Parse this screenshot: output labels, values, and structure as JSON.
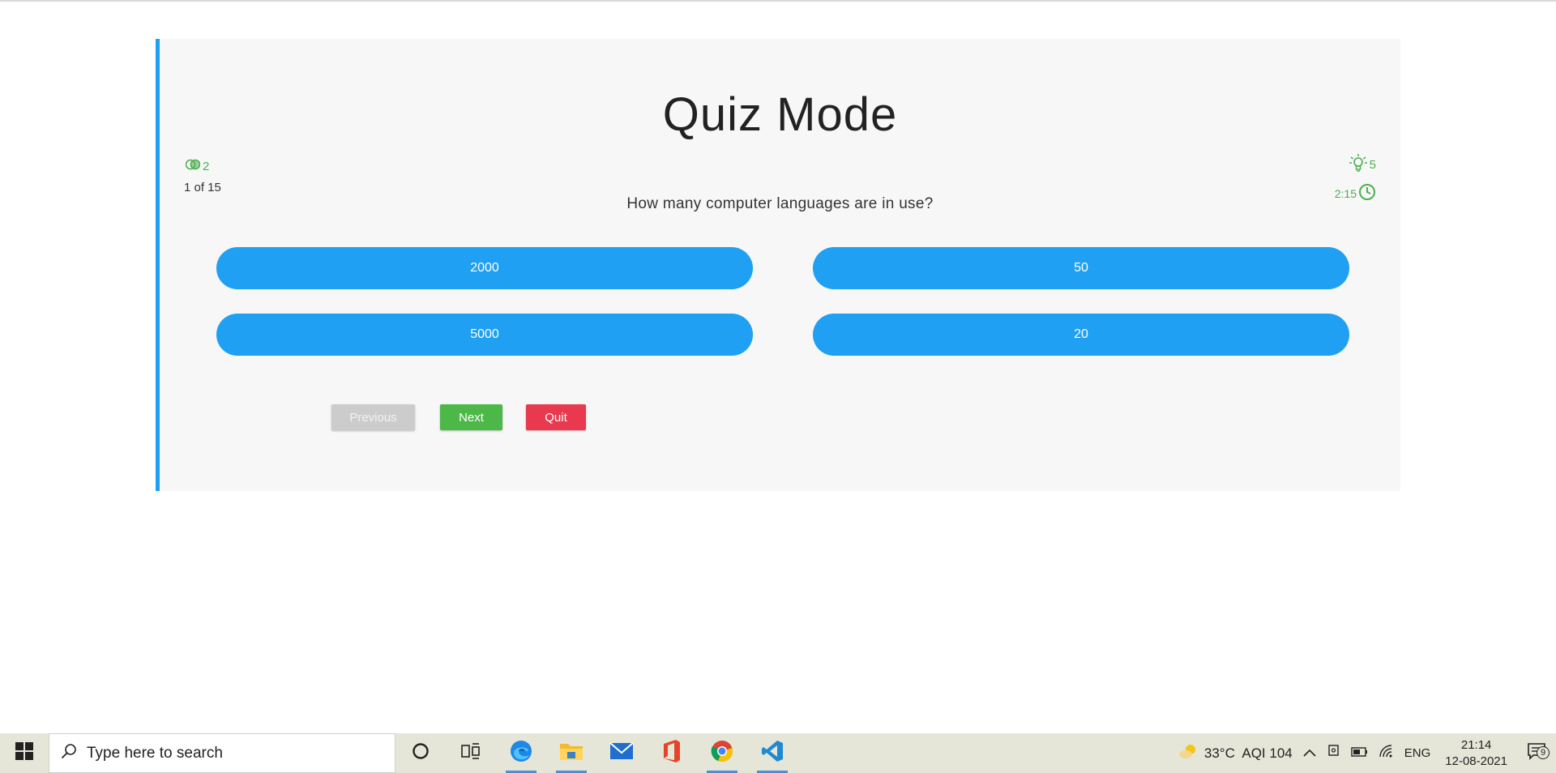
{
  "quiz": {
    "title": "Quiz Mode",
    "fifty_fifty_count": "2",
    "progress": "1 of 15",
    "hints_count": "5",
    "timer": "2:15",
    "question": "How many computer languages are in use?",
    "options": [
      "2000",
      "50",
      "5000",
      "20"
    ],
    "buttons": {
      "previous": "Previous",
      "next": "Next",
      "quit": "Quit"
    }
  },
  "taskbar": {
    "search_placeholder": "Type here to search",
    "weather": "33°C  AQI 104",
    "language": "ENG",
    "time": "21:14",
    "date": "12-08-2021",
    "notification_count": "9"
  },
  "colors": {
    "accent": "#1fa0f2",
    "success": "#4cb848",
    "danger": "#e8394f",
    "disabled": "#cccccc",
    "lifeline_green": "#4caf50"
  }
}
